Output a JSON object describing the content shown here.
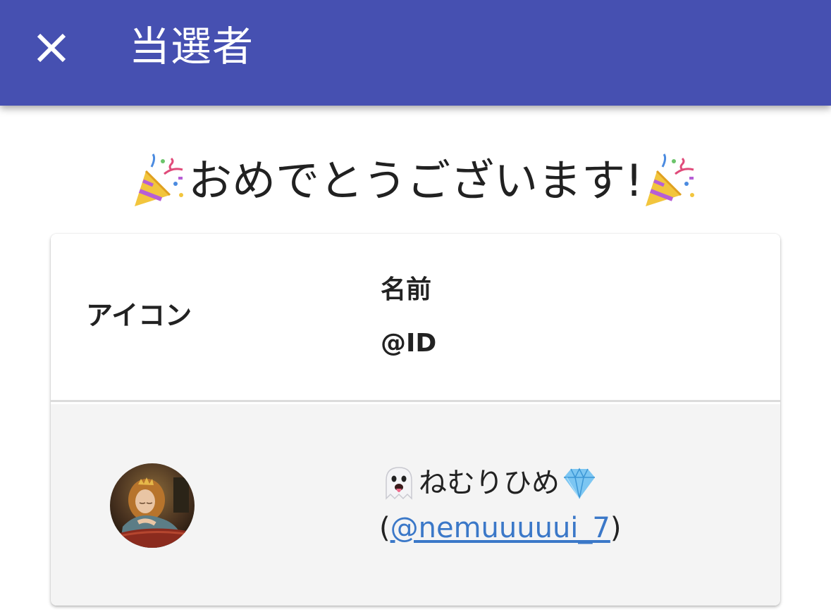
{
  "app_bar": {
    "title": "当選者",
    "close_icon": "close-icon",
    "background_color": "#4650b1"
  },
  "congrats": {
    "text": "おめでとうございます!",
    "left_icon": "party-popper-icon",
    "right_icon": "party-popper-icon"
  },
  "table": {
    "headers": {
      "icon": "アイコン",
      "name": "名前",
      "id": "@ID"
    },
    "rows": [
      {
        "avatar": "sleeping-princess-avatar",
        "name_prefix_icon": "ghost-icon",
        "name": "ねむりひめ",
        "name_suffix_icon": "gem-icon",
        "id_open": "(",
        "id": "@nemuuuuui_7",
        "id_close": ")"
      }
    ]
  },
  "colors": {
    "link": "#3b78c8",
    "row_background": "#f4f4f4"
  }
}
